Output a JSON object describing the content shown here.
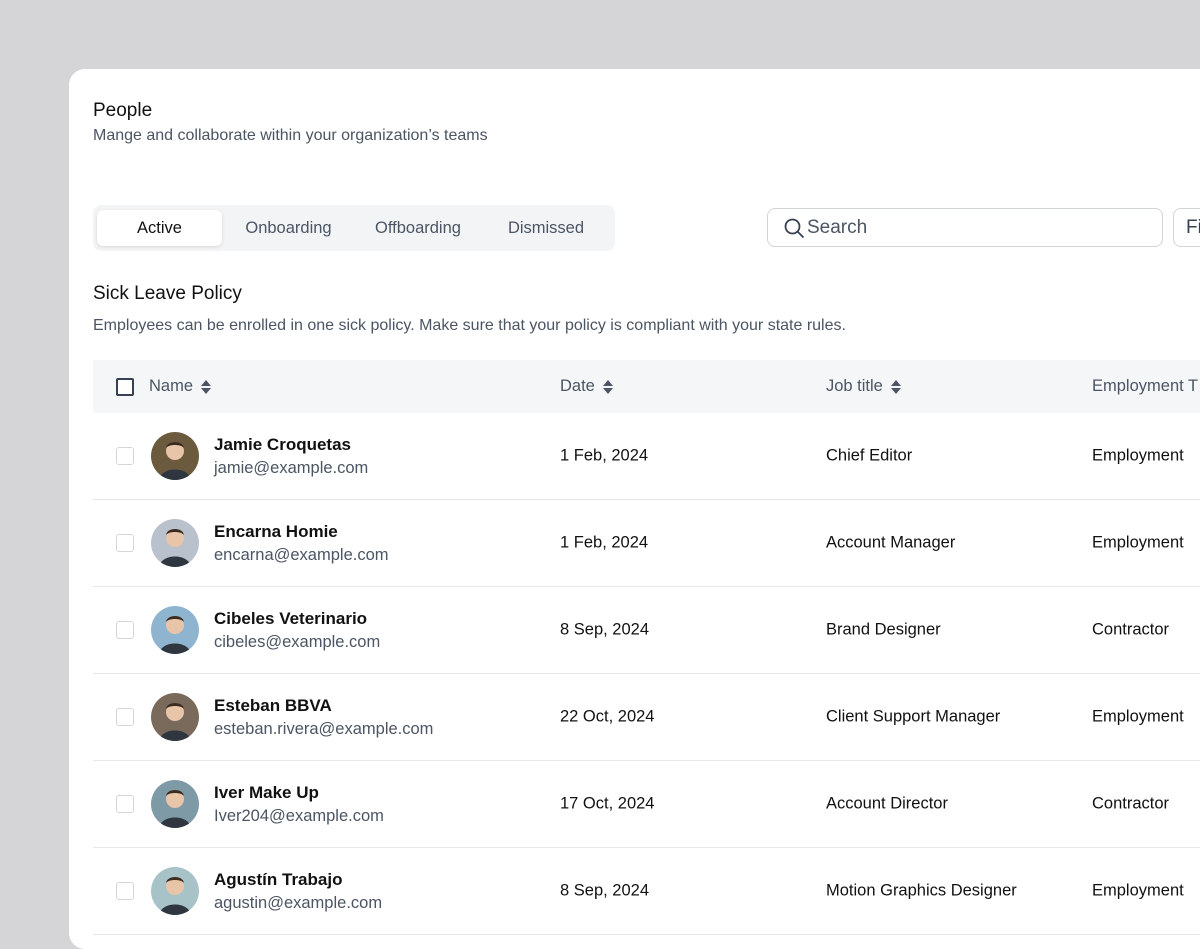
{
  "header": {
    "title": "People",
    "subtitle": "Mange and collaborate within your organization’s teams"
  },
  "tabs": [
    {
      "label": "Active",
      "active": true
    },
    {
      "label": "Onboarding",
      "active": false
    },
    {
      "label": "Offboarding",
      "active": false
    },
    {
      "label": "Dismissed",
      "active": false
    }
  ],
  "search": {
    "placeholder": "Search",
    "icon": "search-icon"
  },
  "filter": {
    "label": "Fi"
  },
  "section": {
    "title": "Sick Leave Policy",
    "description": "Employees can be enrolled in one sick policy. Make sure that your policy is compliant with your state rules."
  },
  "table": {
    "columns": [
      "Name",
      "Date",
      "Job title",
      "Employment T"
    ],
    "rows": [
      {
        "name": "Jamie Croquetas",
        "email": "jamie@example.com",
        "date": "1 Feb, 2024",
        "job": "Chief Editor",
        "employment": "Employment",
        "avatar_color": "#6b5a3e"
      },
      {
        "name": "Encarna Homie",
        "email": "encarna@example.com",
        "date": "1 Feb, 2024",
        "job": "Account Manager",
        "employment": "Employment",
        "avatar_color": "#b9c2cc"
      },
      {
        "name": "Cibeles Veterinario",
        "email": "cibeles@example.com",
        "date": "8 Sep, 2024",
        "job": "Brand Designer",
        "employment": "Contractor",
        "avatar_color": "#8fb4cf"
      },
      {
        "name": "Esteban BBVA",
        "email": "esteban.rivera@example.com",
        "date": "22 Oct, 2024",
        "job": "Client Support Manager",
        "employment": "Employment",
        "avatar_color": "#7a6a5c"
      },
      {
        "name": "Iver Make Up",
        "email": "Iver204@example.com",
        "date": "17 Oct, 2024",
        "job": "Account Director",
        "employment": "Contractor",
        "avatar_color": "#7e9aa6"
      },
      {
        "name": "Agustín Trabajo",
        "email": "agustin@example.com",
        "date": "8 Sep, 2024",
        "job": "Motion Graphics Designer",
        "employment": "Employment",
        "avatar_color": "#a7c3c8"
      }
    ]
  }
}
